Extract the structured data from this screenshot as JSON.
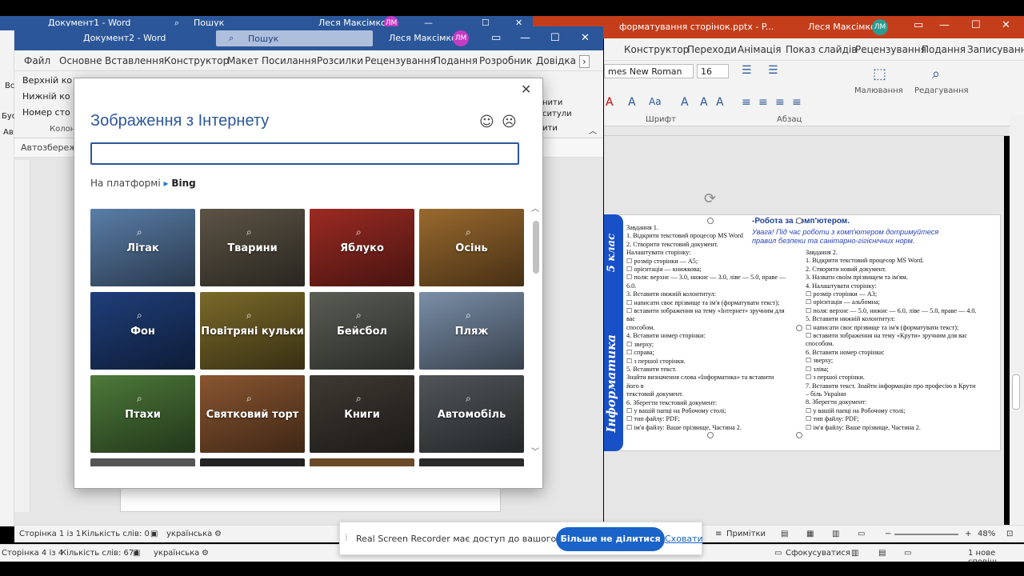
{
  "doc1": {
    "title": "Документ1 - Word",
    "search": "Пошук",
    "user": "Леся Максімко",
    "initials": "ЛМ"
  },
  "ppt": {
    "title": "форматування сторінок.pptx - P...",
    "user": "Леся Максімко",
    "initials": "ЛМ",
    "tabs": [
      "Конструктор",
      "Переходи",
      "Анімація",
      "Показ слайдів",
      "Рецензування",
      "Подання",
      "Записування"
    ],
    "font_name": "mes New Roman",
    "font_size": "16",
    "groups": {
      "font": "Шрифт",
      "paragraph": "Абзац"
    },
    "drawing": "Малювання",
    "editing": "Редагування",
    "notes": "Примітки",
    "zoom": "48%",
    "focus": "Сфокусуватися",
    "notes_status": "1 нове сповіщ"
  },
  "doc2": {
    "title": "Документ2 - Word",
    "search": "Пошук",
    "user": "Леся Максімко",
    "initials": "ЛМ",
    "tabs": [
      "Файл",
      "Основне",
      "Вставлення",
      "Конструктор",
      "Макет",
      "Посилання",
      "Розсилки",
      "Рецензування",
      "Подання",
      "Розробник",
      "Довідка"
    ],
    "ribbon_items": [
      "Верхній ко",
      "Нижній ко",
      "Номер сто"
    ],
    "ribbon_group": "Колонт",
    "ribbon_right": [
      "нити",
      "ситули"
    ],
    "left_labels": [
      "Вс",
      "Буф",
      "Ав"
    ],
    "autosave": "Автозбереже"
  },
  "dialog": {
    "title": "Зображення з Інтернету",
    "search_value": "",
    "powered_prefix": "На платформі",
    "powered_brand": "Bing",
    "tiles": [
      {
        "label": "Літак",
        "bg": "#5a7ea8"
      },
      {
        "label": "Тварини",
        "bg": "#5c5446"
      },
      {
        "label": "Яблуко",
        "bg": "#9c2b23"
      },
      {
        "label": "Осінь",
        "bg": "#9a6a2e"
      },
      {
        "label": "Фон",
        "bg": "#1f3f7a"
      },
      {
        "label": "Повітряні кульки",
        "bg": "#7b6a2a"
      },
      {
        "label": "Бейсбол",
        "bg": "#5b5e55"
      },
      {
        "label": "Пляж",
        "bg": "#7a8fa8"
      },
      {
        "label": "Птахи",
        "bg": "#4d7a3a"
      },
      {
        "label": "Святковий торт",
        "bg": "#8a5630"
      },
      {
        "label": "Книги",
        "bg": "#3e3a33"
      },
      {
        "label": "Автомобіль",
        "bg": "#505658"
      }
    ]
  },
  "status": {
    "doc2_page": "Сторінка 1 із 1",
    "doc2_words": "Кількість слів: 0",
    "doc2_lang": "українська",
    "doc1_page": "Сторінка 4 із 4",
    "doc1_words": "Кількість слів: 674",
    "doc1_lang": "українська"
  },
  "sharebar": {
    "message": "Real Screen Recorder має доступ до вашого екрана.",
    "stop": "Більше не ділитися",
    "hide": "Сховати"
  },
  "slide": {
    "side_title_a": "Інформатика",
    "side_title_b": "5 клас",
    "heading": "-Робота за комп'ютером.",
    "warning_line1": "Увага! Під час роботи з комп'ютером дотримуйтеся",
    "warning_line2": "правил безпеки та санітарно-гігієнічних норм.",
    "col1": [
      "Завдання 1.",
      "1. Відкрити текстовий процесор MS Word",
      "2. Створити текстовий документ.",
      "Налаштувати сторінку:",
      "☐ розмір сторінки — А5;",
      "☐ орієнтація — книжкова;",
      "☐ поля: верхнє — 3.0, нижнє — 3.0, ліве — 5.0, праве —",
      "6.0.",
      "3. Вставити нижній колонтитул:",
      "☐ написати своє прізвище та ім'я (форматувати текст);",
      "☐ вставити зображення на тему «Інтернет» зручним для",
      "вас",
      "способом.",
      "4. Вставити номер сторінки:",
      "☐ зверху;",
      "☐ справа;",
      "☐ з першої сторінки.",
      "5. Вставити текст.",
      "Знайти визначення слова «Інформатика» та вставити",
      "його в",
      "текстовий документ.",
      "6. Зберегти текстовий документ:",
      "☐ у вашій папці на Робочому столі;",
      "☐ тип файлу: PDF;",
      "☐ ім'я файлу: Ваше прізвище, Частина 2."
    ],
    "col2": [
      "Завдання 2.",
      "1. Відкрити текстовий процесор MS Word.",
      "2. Створити новий документ.",
      "3. Назвати своїм прізвищем та ім'ям.",
      "4. Налаштувати сторінку:",
      "☐ розмір сторінки — А3;",
      "☐ орієнтація — альбомна;",
      "☐ поля: верхнє — 5.0, нижнє — 6.0, ліве — 5.0, праве — 4.0.",
      "5. Вставити нижній колонтитул:",
      "☐ написати своє прізвище та ім'я (форматувати текст);",
      "☐ вставити зображення на тему «Крути» зручним для вас",
      "способом.",
      "6. Вставити номер сторінки:",
      "☐ зверху;",
      "☐ зліва;",
      "☐ з першої сторінки.",
      "7. Вставити текст. Знайти інформацію про професію в Крути",
      "– біль України",
      "8. Зберегти документ:",
      "☐ у вашій папці на Робочому столі;",
      "☐ тип файлу: PDF;",
      "☐ ім'я файлу: Ваше прізвище, Частина 2."
    ]
  }
}
